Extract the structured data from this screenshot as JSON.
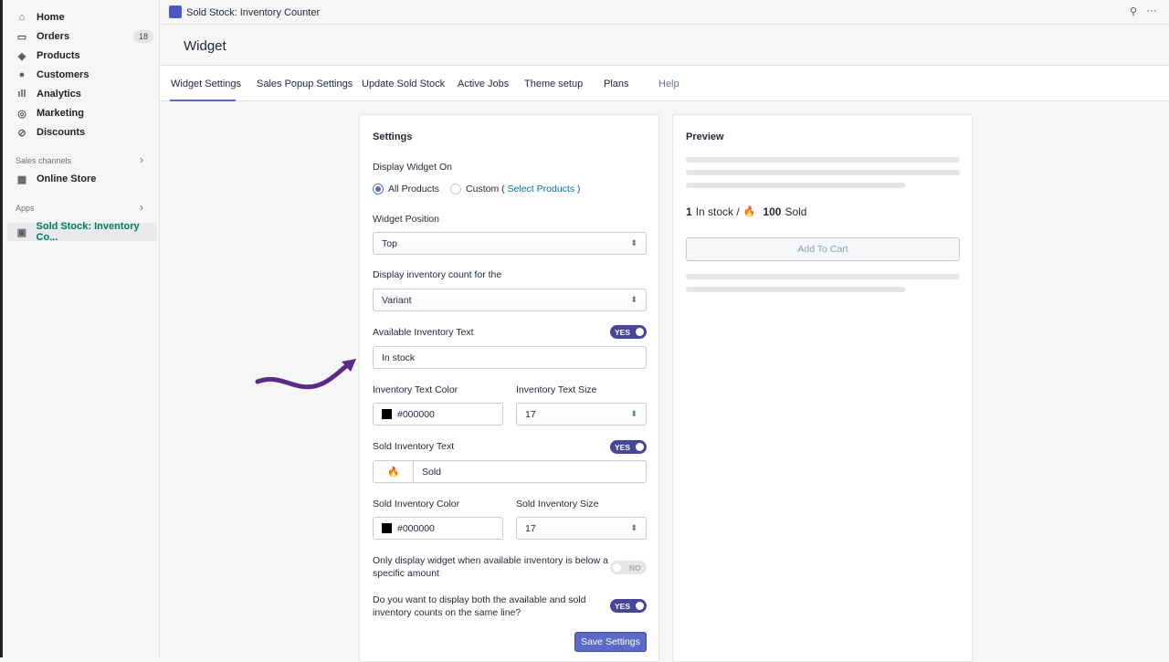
{
  "sidebar": {
    "items": [
      {
        "label": "Home"
      },
      {
        "label": "Orders",
        "badge": "18"
      },
      {
        "label": "Products"
      },
      {
        "label": "Customers"
      },
      {
        "label": "Analytics"
      },
      {
        "label": "Marketing"
      },
      {
        "label": "Discounts"
      }
    ],
    "sales_channels": "Sales channels",
    "online_store": "Online Store",
    "apps": "Apps",
    "app_item": "Sold Stock: Inventory Co..."
  },
  "topbar": {
    "title": "Sold Stock: Inventory Counter"
  },
  "header": {
    "title": "Widget"
  },
  "tabs": [
    "Widget Settings",
    "Sales Popup Settings",
    "Update Sold Stock",
    "Active Jobs",
    "Theme setup",
    "Plans",
    "Help"
  ],
  "settings": {
    "title": "Settings",
    "display_on_label": "Display Widget On",
    "all_products": "All Products",
    "custom": "Custom (",
    "select_products": "Select Products",
    "custom_close": ")",
    "position_label": "Widget Position",
    "position_value": "Top",
    "count_for_label": "Display inventory count for the",
    "count_for_value": "Variant",
    "avail_text_label": "Available Inventory Text",
    "avail_toggle": "YES",
    "avail_text_value": "In stock",
    "inv_color_label": "Inventory Text Color",
    "inv_color_value": "#000000",
    "inv_size_label": "Inventory Text Size",
    "inv_size_value": "17",
    "sold_text_label": "Sold Inventory Text",
    "sold_toggle": "YES",
    "sold_emoji": "🔥",
    "sold_text_value": "Sold",
    "sold_color_label": "Sold Inventory Color",
    "sold_color_value": "#000000",
    "sold_size_label": "Sold Inventory Size",
    "sold_size_value": "17",
    "below_label": "Only display widget when available inventory is below a specific amount",
    "below_toggle": "NO",
    "same_line_label": "Do you want to display both the available and sold inventory counts on the same line?",
    "same_line_toggle": "YES",
    "save": "Save Settings"
  },
  "preview": {
    "title": "Preview",
    "in_count": "1",
    "in_text": "In stock /",
    "emoji": "🔥",
    "sold_count": "100",
    "sold_text": "Sold",
    "add_to_cart": "Add To Cart"
  },
  "colors": {
    "accent": "#47479a",
    "button": "#5c6ac4",
    "arrow": "#5b2a86"
  }
}
